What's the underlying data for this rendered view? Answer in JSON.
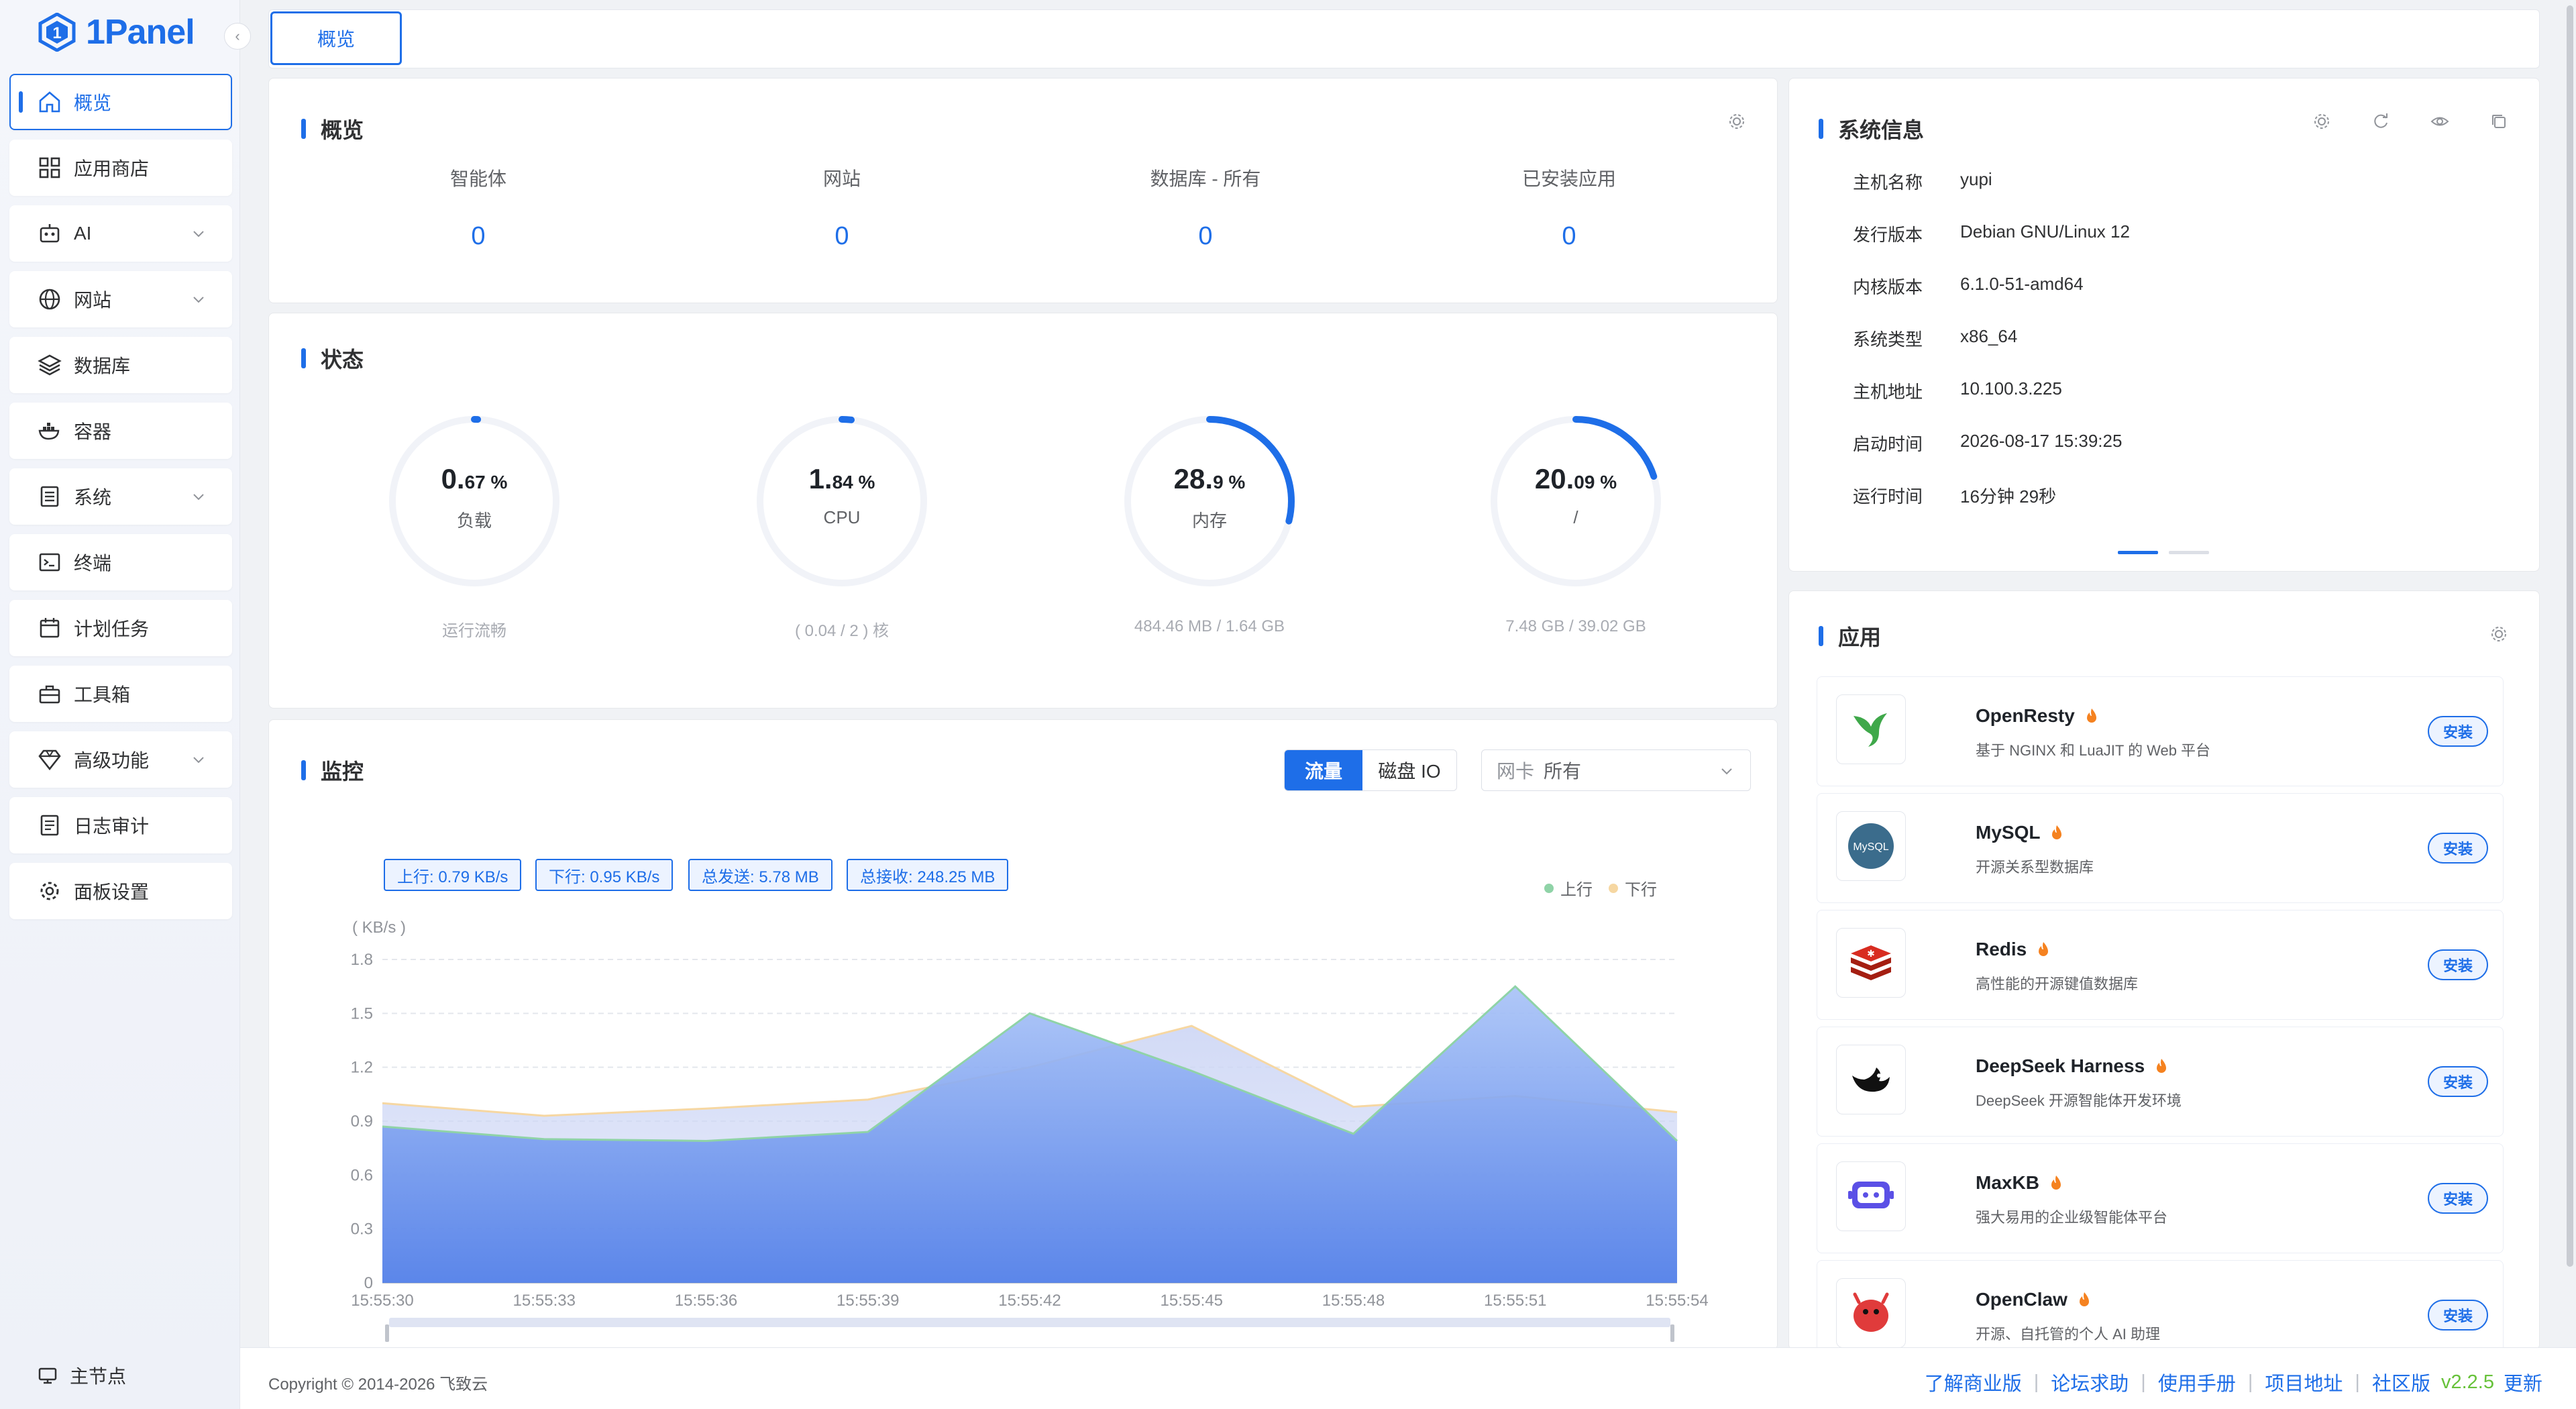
{
  "brand": {
    "name": "1Panel"
  },
  "sidebar": {
    "items": [
      {
        "label": "概览",
        "icon": "home-icon",
        "active": true
      },
      {
        "label": "应用商店",
        "icon": "grid-icon"
      },
      {
        "label": "AI",
        "icon": "robot-icon",
        "expandable": true
      },
      {
        "label": "网站",
        "icon": "globe-icon",
        "expandable": true
      },
      {
        "label": "数据库",
        "icon": "layers-icon"
      },
      {
        "label": "容器",
        "icon": "docker-icon"
      },
      {
        "label": "系统",
        "icon": "server-icon",
        "expandable": true
      },
      {
        "label": "终端",
        "icon": "terminal-icon"
      },
      {
        "label": "计划任务",
        "icon": "calendar-icon"
      },
      {
        "label": "工具箱",
        "icon": "toolbox-icon"
      },
      {
        "label": "高级功能",
        "icon": "diamond-icon",
        "expandable": true
      },
      {
        "label": "日志审计",
        "icon": "log-icon"
      },
      {
        "label": "面板设置",
        "icon": "gear-icon"
      }
    ],
    "footer_label": "主节点"
  },
  "tabs": [
    {
      "label": "概览"
    }
  ],
  "overview": {
    "title": "概览",
    "stats": [
      {
        "label": "智能体",
        "value": "0"
      },
      {
        "label": "网站",
        "value": "0"
      },
      {
        "label": "数据库 - 所有",
        "value": "0"
      },
      {
        "label": "已安装应用",
        "value": "0"
      }
    ]
  },
  "status": {
    "title": "状态",
    "gauges": [
      {
        "int": "0.",
        "dec": "67 %",
        "name": "负载",
        "sub": "运行流畅",
        "percent": 0.67
      },
      {
        "int": "1.",
        "dec": "84 %",
        "name": "CPU",
        "sub": "( 0.04 / 2 ) 核",
        "percent": 1.84
      },
      {
        "int": "28.",
        "dec": "9 %",
        "name": "内存",
        "sub": "484.46 MB / 1.64 GB",
        "percent": 28.9
      },
      {
        "int": "20.",
        "dec": "09 %",
        "name": "/",
        "sub": "7.48 GB / 39.02 GB",
        "percent": 20.09
      }
    ]
  },
  "monitor": {
    "title": "监控",
    "segments": [
      "流量",
      "磁盘 IO"
    ],
    "nic_label": "网卡",
    "nic_value": "所有",
    "badges": [
      "上行: 0.79 KB/s",
      "下行: 0.95 KB/s",
      "总发送: 5.78 MB",
      "总接收: 248.25 MB"
    ]
  },
  "chart_data": {
    "type": "area",
    "ylabel": "( KB/s )",
    "ylim": [
      0,
      1.8
    ],
    "yticks": [
      "0",
      "0.3",
      "0.6",
      "0.9",
      "1.2",
      "1.5",
      "1.8"
    ],
    "x": [
      "15:55:30",
      "15:55:33",
      "15:55:36",
      "15:55:39",
      "15:55:42",
      "15:55:45",
      "15:55:48",
      "15:55:51",
      "15:55:54"
    ],
    "series": [
      {
        "name": "上行",
        "color": "#8fd3a7",
        "values": [
          0.87,
          0.8,
          0.79,
          0.84,
          1.5,
          1.18,
          0.83,
          1.65,
          0.79
        ]
      },
      {
        "name": "下行",
        "color": "#f6d7a2",
        "values": [
          1.0,
          0.93,
          0.97,
          1.02,
          1.2,
          1.43,
          0.98,
          1.04,
          0.95
        ]
      }
    ],
    "legend": "top-right"
  },
  "sysinfo": {
    "title": "系统信息",
    "rows": [
      {
        "k": "主机名称",
        "v": "yupi"
      },
      {
        "k": "发行版本",
        "v": "Debian GNU/Linux 12"
      },
      {
        "k": "内核版本",
        "v": "6.1.0-51-amd64"
      },
      {
        "k": "系统类型",
        "v": "x86_64"
      },
      {
        "k": "主机地址",
        "v": "10.100.3.225"
      },
      {
        "k": "启动时间",
        "v": "2026-08-17 15:39:25"
      },
      {
        "k": "运行时间",
        "v": "16分钟 29秒"
      }
    ]
  },
  "apps": {
    "title": "应用",
    "install_label": "安装",
    "items": [
      {
        "name": "OpenResty",
        "desc": "基于 NGINX 和 LuaJIT 的 Web 平台",
        "icon": "openresty-icon"
      },
      {
        "name": "MySQL",
        "desc": "开源关系型数据库",
        "icon": "mysql-icon"
      },
      {
        "name": "Redis",
        "desc": "高性能的开源键值数据库",
        "icon": "redis-icon"
      },
      {
        "name": "DeepSeek Harness",
        "desc": "DeepSeek 开源智能体开发环境",
        "icon": "deepseek-icon"
      },
      {
        "name": "MaxKB",
        "desc": "强大易用的企业级智能体平台",
        "icon": "maxkb-icon"
      },
      {
        "name": "OpenClaw",
        "desc": "开源、自托管的个人 AI 助理",
        "icon": "openclaw-icon"
      }
    ]
  },
  "footer": {
    "copyright": "Copyright © 2014-2026 飞致云",
    "links": [
      "了解商业版",
      "论坛求助",
      "使用手册",
      "项目地址"
    ],
    "edition": "社区版",
    "version": "v2.2.5",
    "update": "更新"
  },
  "colors": {
    "primary": "#1e6ee8",
    "success": "#67c23a",
    "hot": "#f58220"
  }
}
